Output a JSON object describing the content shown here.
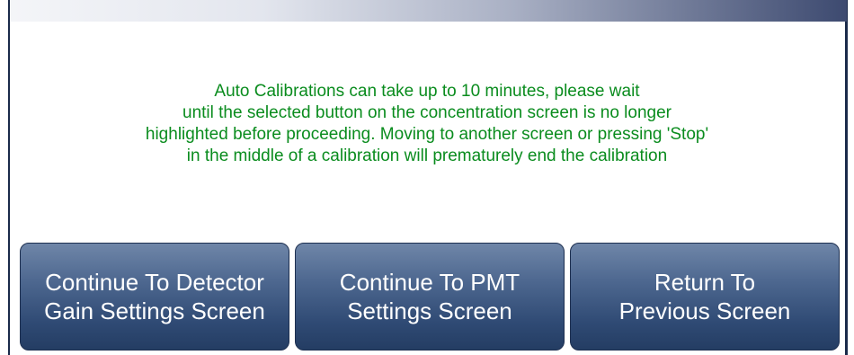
{
  "message": {
    "lines": [
      "Auto Calibrations can take up to 10 minutes, please wait",
      "until the selected button on the concentration screen is no longer",
      "highlighted before proceeding. Moving to another screen or pressing 'Stop'",
      "in the middle of a calibration will prematurely end the calibration"
    ],
    "color": "#0a8c1e"
  },
  "buttons": [
    {
      "line1": "Continue To Detector",
      "line2": "Gain Settings Screen"
    },
    {
      "line1": "Continue To PMT",
      "line2": "Settings Screen"
    },
    {
      "line1": "Return To",
      "line2": "Previous Screen"
    }
  ],
  "colors": {
    "button": "#2f4a74",
    "frame": "#1a2a4a"
  }
}
